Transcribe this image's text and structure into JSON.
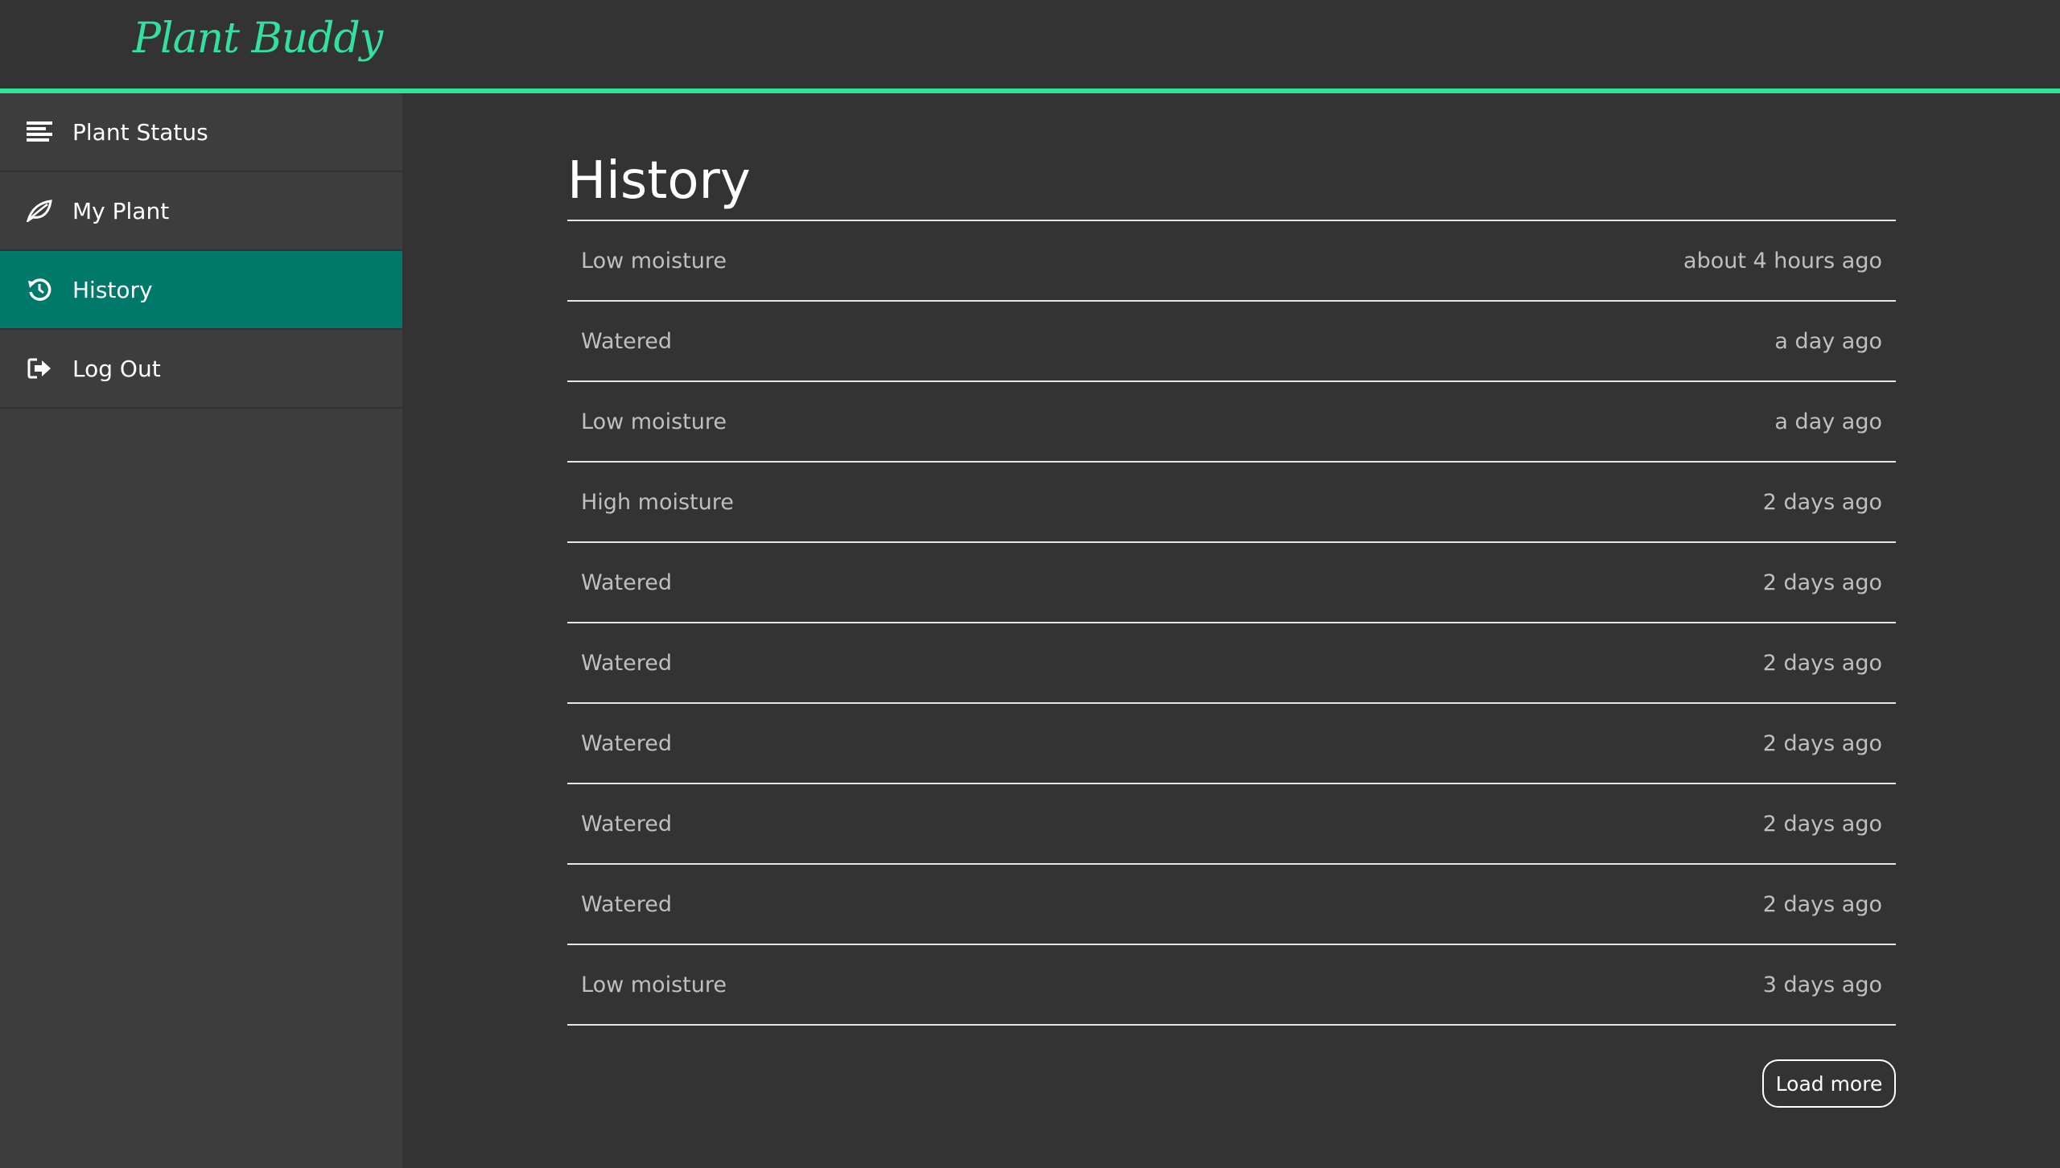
{
  "app": {
    "logo_text": "Plant Buddy",
    "accent_color": "#2fe39a",
    "active_color": "#00796b"
  },
  "sidebar": {
    "items": [
      {
        "label": "Plant Status",
        "icon": "bars-icon",
        "active": false
      },
      {
        "label": "My Plant",
        "icon": "leaf-icon",
        "active": false
      },
      {
        "label": "History",
        "icon": "history-icon",
        "active": true
      },
      {
        "label": "Log Out",
        "icon": "sign-out-icon",
        "active": false
      }
    ]
  },
  "main": {
    "title": "History",
    "rows": [
      {
        "event": "Low moisture",
        "time": "about 4 hours ago"
      },
      {
        "event": "Watered",
        "time": "a day ago"
      },
      {
        "event": "Low moisture",
        "time": "a day ago"
      },
      {
        "event": "High moisture",
        "time": "2 days ago"
      },
      {
        "event": "Watered",
        "time": "2 days ago"
      },
      {
        "event": "Watered",
        "time": "2 days ago"
      },
      {
        "event": "Watered",
        "time": "2 days ago"
      },
      {
        "event": "Watered",
        "time": "2 days ago"
      },
      {
        "event": "Watered",
        "time": "2 days ago"
      },
      {
        "event": "Low moisture",
        "time": "3 days ago"
      }
    ],
    "load_more_label": "Load more"
  }
}
